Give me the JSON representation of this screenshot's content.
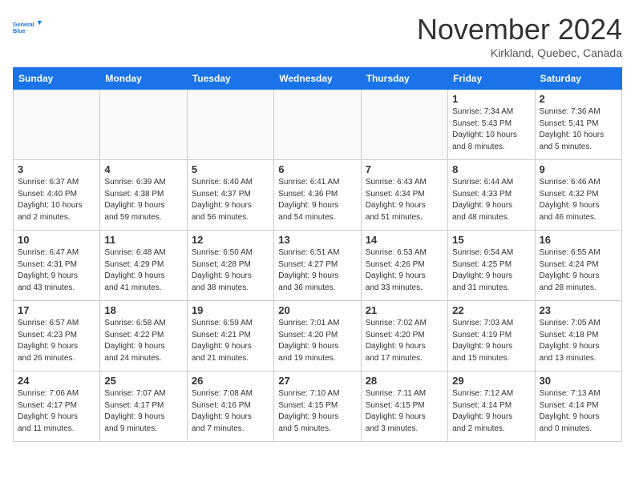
{
  "header": {
    "logo_line1": "General",
    "logo_line2": "Blue",
    "month": "November 2024",
    "location": "Kirkland, Quebec, Canada"
  },
  "weekdays": [
    "Sunday",
    "Monday",
    "Tuesday",
    "Wednesday",
    "Thursday",
    "Friday",
    "Saturday"
  ],
  "weeks": [
    [
      {
        "day": "",
        "info": ""
      },
      {
        "day": "",
        "info": ""
      },
      {
        "day": "",
        "info": ""
      },
      {
        "day": "",
        "info": ""
      },
      {
        "day": "",
        "info": ""
      },
      {
        "day": "1",
        "info": "Sunrise: 7:34 AM\nSunset: 5:43 PM\nDaylight: 10 hours\nand 8 minutes."
      },
      {
        "day": "2",
        "info": "Sunrise: 7:36 AM\nSunset: 5:41 PM\nDaylight: 10 hours\nand 5 minutes."
      }
    ],
    [
      {
        "day": "3",
        "info": "Sunrise: 6:37 AM\nSunset: 4:40 PM\nDaylight: 10 hours\nand 2 minutes."
      },
      {
        "day": "4",
        "info": "Sunrise: 6:39 AM\nSunset: 4:38 PM\nDaylight: 9 hours\nand 59 minutes."
      },
      {
        "day": "5",
        "info": "Sunrise: 6:40 AM\nSunset: 4:37 PM\nDaylight: 9 hours\nand 56 minutes."
      },
      {
        "day": "6",
        "info": "Sunrise: 6:41 AM\nSunset: 4:36 PM\nDaylight: 9 hours\nand 54 minutes."
      },
      {
        "day": "7",
        "info": "Sunrise: 6:43 AM\nSunset: 4:34 PM\nDaylight: 9 hours\nand 51 minutes."
      },
      {
        "day": "8",
        "info": "Sunrise: 6:44 AM\nSunset: 4:33 PM\nDaylight: 9 hours\nand 48 minutes."
      },
      {
        "day": "9",
        "info": "Sunrise: 6:46 AM\nSunset: 4:32 PM\nDaylight: 9 hours\nand 46 minutes."
      }
    ],
    [
      {
        "day": "10",
        "info": "Sunrise: 6:47 AM\nSunset: 4:31 PM\nDaylight: 9 hours\nand 43 minutes."
      },
      {
        "day": "11",
        "info": "Sunrise: 6:48 AM\nSunset: 4:29 PM\nDaylight: 9 hours\nand 41 minutes."
      },
      {
        "day": "12",
        "info": "Sunrise: 6:50 AM\nSunset: 4:28 PM\nDaylight: 9 hours\nand 38 minutes."
      },
      {
        "day": "13",
        "info": "Sunrise: 6:51 AM\nSunset: 4:27 PM\nDaylight: 9 hours\nand 36 minutes."
      },
      {
        "day": "14",
        "info": "Sunrise: 6:53 AM\nSunset: 4:26 PM\nDaylight: 9 hours\nand 33 minutes."
      },
      {
        "day": "15",
        "info": "Sunrise: 6:54 AM\nSunset: 4:25 PM\nDaylight: 9 hours\nand 31 minutes."
      },
      {
        "day": "16",
        "info": "Sunrise: 6:55 AM\nSunset: 4:24 PM\nDaylight: 9 hours\nand 28 minutes."
      }
    ],
    [
      {
        "day": "17",
        "info": "Sunrise: 6:57 AM\nSunset: 4:23 PM\nDaylight: 9 hours\nand 26 minutes."
      },
      {
        "day": "18",
        "info": "Sunrise: 6:58 AM\nSunset: 4:22 PM\nDaylight: 9 hours\nand 24 minutes."
      },
      {
        "day": "19",
        "info": "Sunrise: 6:59 AM\nSunset: 4:21 PM\nDaylight: 9 hours\nand 21 minutes."
      },
      {
        "day": "20",
        "info": "Sunrise: 7:01 AM\nSunset: 4:20 PM\nDaylight: 9 hours\nand 19 minutes."
      },
      {
        "day": "21",
        "info": "Sunrise: 7:02 AM\nSunset: 4:20 PM\nDaylight: 9 hours\nand 17 minutes."
      },
      {
        "day": "22",
        "info": "Sunrise: 7:03 AM\nSunset: 4:19 PM\nDaylight: 9 hours\nand 15 minutes."
      },
      {
        "day": "23",
        "info": "Sunrise: 7:05 AM\nSunset: 4:18 PM\nDaylight: 9 hours\nand 13 minutes."
      }
    ],
    [
      {
        "day": "24",
        "info": "Sunrise: 7:06 AM\nSunset: 4:17 PM\nDaylight: 9 hours\nand 11 minutes."
      },
      {
        "day": "25",
        "info": "Sunrise: 7:07 AM\nSunset: 4:17 PM\nDaylight: 9 hours\nand 9 minutes."
      },
      {
        "day": "26",
        "info": "Sunrise: 7:08 AM\nSunset: 4:16 PM\nDaylight: 9 hours\nand 7 minutes."
      },
      {
        "day": "27",
        "info": "Sunrise: 7:10 AM\nSunset: 4:15 PM\nDaylight: 9 hours\nand 5 minutes."
      },
      {
        "day": "28",
        "info": "Sunrise: 7:11 AM\nSunset: 4:15 PM\nDaylight: 9 hours\nand 3 minutes."
      },
      {
        "day": "29",
        "info": "Sunrise: 7:12 AM\nSunset: 4:14 PM\nDaylight: 9 hours\nand 2 minutes."
      },
      {
        "day": "30",
        "info": "Sunrise: 7:13 AM\nSunset: 4:14 PM\nDaylight: 9 hours\nand 0 minutes."
      }
    ]
  ]
}
